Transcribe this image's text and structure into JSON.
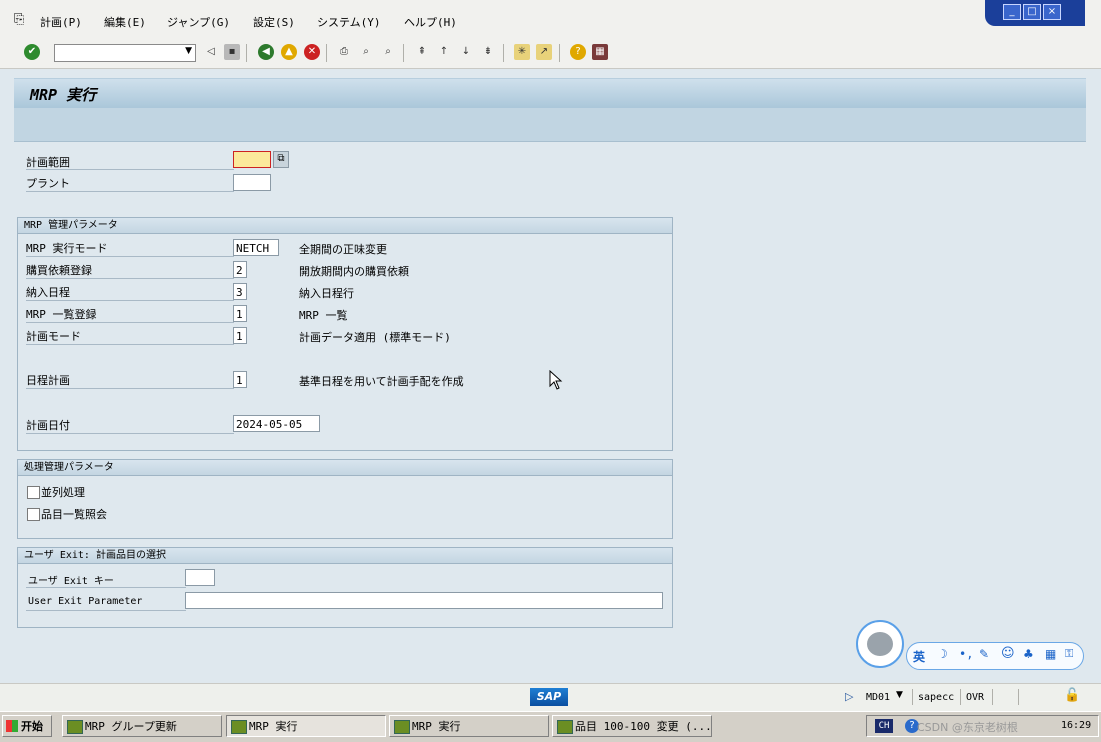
{
  "menu": {
    "items": [
      "計画(P)",
      "編集(E)",
      "ジャンプ(G)",
      "設定(S)",
      "システム(Y)",
      "ヘルプ(H)"
    ]
  },
  "window_controls": {
    "minimize": "_",
    "restore": "□",
    "close": "×"
  },
  "page_title": "MRP 実行",
  "fields": {
    "plan_scope_label": "計画範囲",
    "plant_label": "プラント"
  },
  "mrp_group": {
    "title": "MRP 管理パラメータ",
    "rows": [
      {
        "label": "MRP 実行モード",
        "value": "NETCH",
        "desc": "全期間の正味変更"
      },
      {
        "label": "購買依頼登録",
        "value": "2",
        "desc": "開放期間内の購買依頼"
      },
      {
        "label": "納入日程",
        "value": "3",
        "desc": "納入日程行"
      },
      {
        "label": "MRP 一覧登録",
        "value": "1",
        "desc": "MRP 一覧"
      },
      {
        "label": "計画モード",
        "value": "1",
        "desc": "計画データ適用 (標準モード)"
      },
      {
        "label": "日程計画",
        "value": "1",
        "desc": "基準日程を用いて計画手配を作成"
      },
      {
        "label": "計画日付",
        "value": "2024-05-05",
        "desc": ""
      }
    ]
  },
  "process_group": {
    "title": "処理管理パラメータ",
    "options": [
      "並列処理",
      "品目一覧照会"
    ]
  },
  "exit_group": {
    "title": "ユーザ Exit: 計画品目の選択",
    "exit_key_label": "ユーザ Exit キー",
    "exit_param_label": "User Exit Parameter"
  },
  "status": {
    "sap_logo": "SAP",
    "transaction": "MD01",
    "server": "sapecc",
    "mode": "OVR"
  },
  "taskbar": {
    "start": "开始",
    "tasks": [
      "MRP グループ更新",
      "MRP 実行",
      "MRP 実行",
      "品目 100-100 変更 (..."
    ],
    "lang": "CH",
    "time": "16:29",
    "watermark": "CSDN @东京老树根"
  },
  "ime": {
    "label": "英"
  }
}
